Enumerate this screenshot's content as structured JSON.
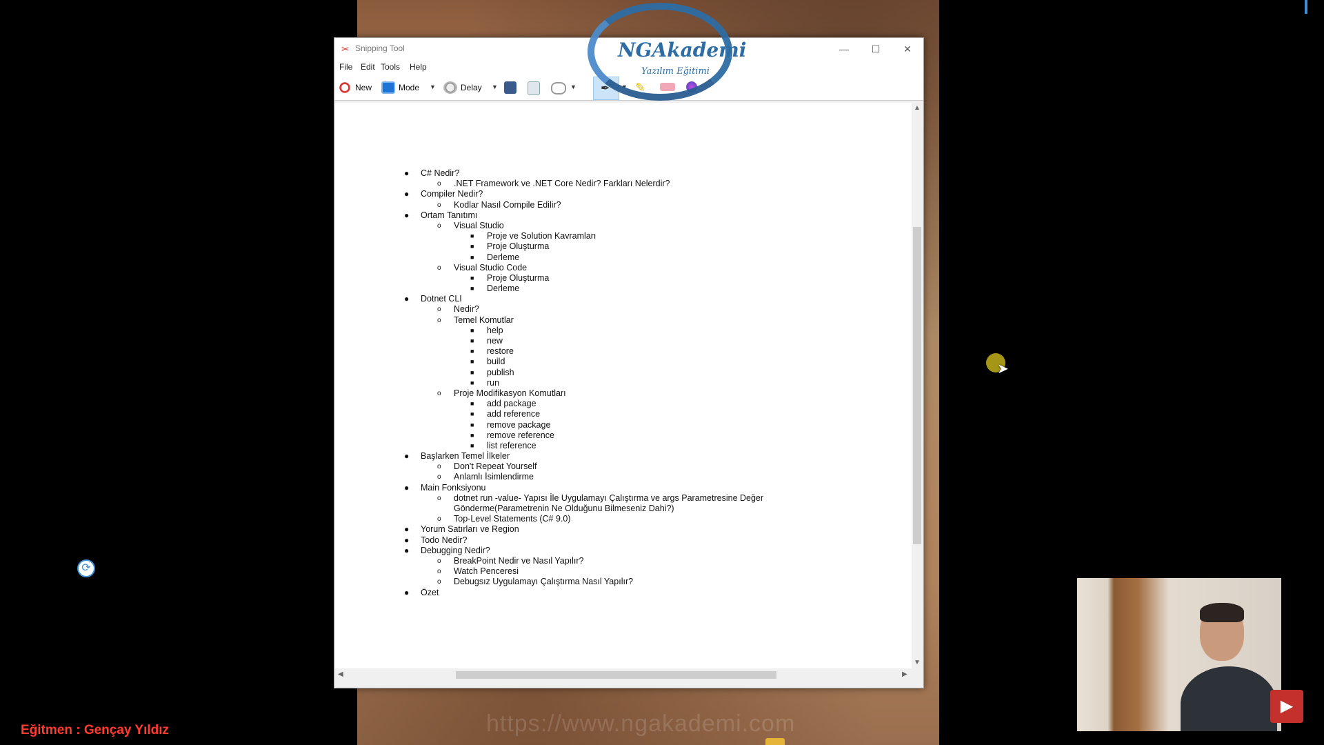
{
  "window": {
    "title": "Snipping Tool",
    "controls": {
      "minimize": "—",
      "maximize": "☐",
      "close": "✕"
    }
  },
  "menu": [
    "File",
    "Edit",
    "Tools",
    "Help"
  ],
  "toolbar": {
    "new_label": "New",
    "mode_label": "Mode",
    "delay_label": "Delay"
  },
  "logo": {
    "name": "NGAkademi",
    "tagline": "Yazılım Eğitimi"
  },
  "watermark_url": "https://www.ngakademi.com",
  "outline": [
    {
      "level": 0,
      "text": "C# Nedir?"
    },
    {
      "level": 1,
      "text": ".NET Framework ve .NET Core Nedir? Farkları Nelerdir?"
    },
    {
      "level": 0,
      "text": "Compiler Nedir?"
    },
    {
      "level": 1,
      "text": "Kodlar Nasıl Compile Edilir?"
    },
    {
      "level": 0,
      "text": "Ortam Tanıtımı"
    },
    {
      "level": 1,
      "text": "Visual Studio"
    },
    {
      "level": 2,
      "text": "Proje ve Solution Kavramları"
    },
    {
      "level": 2,
      "text": "Proje Oluşturma"
    },
    {
      "level": 2,
      "text": "Derleme"
    },
    {
      "level": 1,
      "text": "Visual Studio Code"
    },
    {
      "level": 2,
      "text": "Proje Oluşturma"
    },
    {
      "level": 2,
      "text": "Derleme"
    },
    {
      "level": 0,
      "text": "Dotnet CLI"
    },
    {
      "level": 1,
      "text": "Nedir?"
    },
    {
      "level": 1,
      "text": "Temel Komutlar"
    },
    {
      "level": 2,
      "text": "help"
    },
    {
      "level": 2,
      "text": "new"
    },
    {
      "level": 2,
      "text": "restore"
    },
    {
      "level": 2,
      "text": "build"
    },
    {
      "level": 2,
      "text": "publish"
    },
    {
      "level": 2,
      "text": "run"
    },
    {
      "level": 1,
      "text": "Proje Modifikasyon Komutları"
    },
    {
      "level": 2,
      "text": "add package"
    },
    {
      "level": 2,
      "text": "add reference"
    },
    {
      "level": 2,
      "text": "remove package"
    },
    {
      "level": 2,
      "text": "remove reference"
    },
    {
      "level": 2,
      "text": "list reference"
    },
    {
      "level": 0,
      "text": "Başlarken Temel İlkeler"
    },
    {
      "level": 1,
      "text": "Don't Repeat Yourself"
    },
    {
      "level": 1,
      "text": "Anlamlı İsimlendirme"
    },
    {
      "level": 0,
      "text": "Main Fonksiyonu"
    },
    {
      "level": 1,
      "text": "dotnet run -value- Yapısı İle Uygulamayı Çalıştırma ve args Parametresine Değer"
    },
    {
      "level": 1,
      "text": "Gönderme(Parametrenin Ne Olduğunu Bilmeseniz Dahi?)",
      "continuation": true
    },
    {
      "level": 1,
      "text": "Top-Level Statements (C# 9.0)"
    },
    {
      "level": 0,
      "text": "Yorum Satırları ve Region"
    },
    {
      "level": 0,
      "text": "Todo Nedir?"
    },
    {
      "level": 0,
      "text": "Debugging Nedir?"
    },
    {
      "level": 1,
      "text": "BreakPoint Nedir ve Nasıl Yapılır?"
    },
    {
      "level": 1,
      "text": "Watch Penceresi"
    },
    {
      "level": 1,
      "text": "Debugsız Uygulamayı Çalıştırma Nasıl Yapılır?"
    },
    {
      "level": 0,
      "text": "Özet"
    }
  ],
  "bullets": {
    "0": "●",
    "1": "o",
    "2": "■"
  },
  "instructor": "Eğitmen : Gençay Yıldız",
  "colors": {
    "accent": "#2e6da4",
    "instructor": "#ff3b30",
    "cursor_halo": "#dcc81e"
  }
}
